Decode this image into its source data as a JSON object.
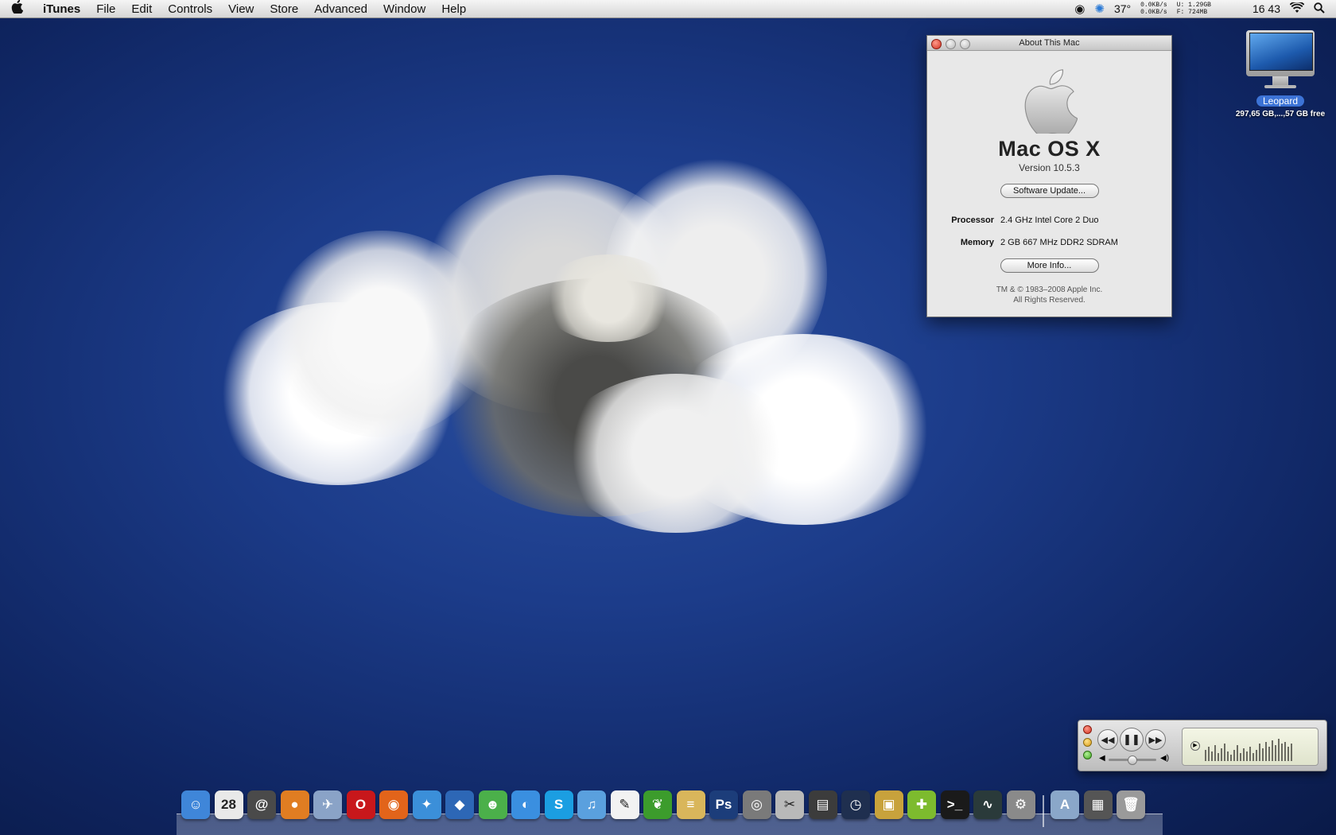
{
  "menubar": {
    "app_name": "iTunes",
    "items": [
      "File",
      "Edit",
      "Controls",
      "View",
      "Store",
      "Advanced",
      "Window",
      "Help"
    ],
    "weather": "37°",
    "net_down": "0.0KB/s",
    "net_up": "0.0KB/s",
    "mem_used_label": "U:",
    "mem_used": "1.29GB",
    "mem_free_label": "F:",
    "mem_free": "724MB",
    "clock": "16 43"
  },
  "about": {
    "title": "About This Mac",
    "os_name": "Mac OS X",
    "version": "Version 10.5.3",
    "software_update": "Software Update...",
    "processor_label": "Processor",
    "processor_value": "2.4 GHz Intel Core 2 Duo",
    "memory_label": "Memory",
    "memory_value": "2 GB 667 MHz DDR2 SDRAM",
    "more_info": "More Info...",
    "copyright_line1": "TM & © 1983–2008 Apple Inc.",
    "copyright_line2": "All Rights Reserved."
  },
  "desktop_icon": {
    "name": "Leopard",
    "subtitle": "297,65 GB,...,57 GB free"
  },
  "dock": {
    "items": [
      {
        "name": "finder-icon",
        "glyph": "☺",
        "color": "#3f86d9"
      },
      {
        "name": "ical-icon",
        "glyph": "28",
        "color": "#e9e9e9"
      },
      {
        "name": "address-book-icon",
        "glyph": "@",
        "color": "#4a4a4a"
      },
      {
        "name": "adium-icon",
        "glyph": "●",
        "color": "#e07d22"
      },
      {
        "name": "preview-icon",
        "glyph": "✈",
        "color": "#8aa3c7"
      },
      {
        "name": "opera-icon",
        "glyph": "O",
        "color": "#c8171b"
      },
      {
        "name": "firefox-icon",
        "glyph": "◉",
        "color": "#e2641a"
      },
      {
        "name": "safari-icon",
        "glyph": "✦",
        "color": "#3b8fd9"
      },
      {
        "name": "adium-duck-icon",
        "glyph": "◆",
        "color": "#2d67b6"
      },
      {
        "name": "msn-messenger-icon",
        "glyph": "☻",
        "color": "#4bb04a"
      },
      {
        "name": "ichat-icon",
        "glyph": "◐",
        "color": "#3a8fe0"
      },
      {
        "name": "skype-icon",
        "glyph": "S",
        "color": "#1b9ee2"
      },
      {
        "name": "itunes-icon",
        "glyph": "♫",
        "color": "#5aa0de"
      },
      {
        "name": "textedit-icon",
        "glyph": "✎",
        "color": "#f2f2f2"
      },
      {
        "name": "coda-leaf-icon",
        "glyph": "❦",
        "color": "#3c9c2c"
      },
      {
        "name": "notes-icon",
        "glyph": "≡",
        "color": "#d9b65b"
      },
      {
        "name": "photoshop-icon",
        "glyph": "Ps",
        "color": "#1c3d7a"
      },
      {
        "name": "ripper-icon",
        "glyph": "◎",
        "color": "#7a7a7a"
      },
      {
        "name": "disk-utility-icon",
        "glyph": "✂",
        "color": "#b9b9b9"
      },
      {
        "name": "movie-icon",
        "glyph": "▤",
        "color": "#3c3c3c"
      },
      {
        "name": "time-machine-icon",
        "glyph": "◷",
        "color": "#1f2f4f"
      },
      {
        "name": "transmit-icon",
        "glyph": "▣",
        "color": "#c8a23c"
      },
      {
        "name": "hair-dryer-icon",
        "glyph": "✚",
        "color": "#7dbb2e"
      },
      {
        "name": "terminal-icon",
        "glyph": ">_",
        "color": "#1a1a1a"
      },
      {
        "name": "activity-monitor-icon",
        "glyph": "∿",
        "color": "#2a3a3a"
      },
      {
        "name": "system-preferences-icon",
        "glyph": "⚙",
        "color": "#8a8a8a"
      },
      {
        "name": "applications-folder-icon",
        "glyph": "A",
        "color": "#8aa7c9"
      },
      {
        "name": "documents-stack-icon",
        "glyph": "▦",
        "color": "#555555"
      },
      {
        "name": "trash-icon",
        "glyph": "🗑",
        "color": "#9a9a9a"
      }
    ]
  }
}
